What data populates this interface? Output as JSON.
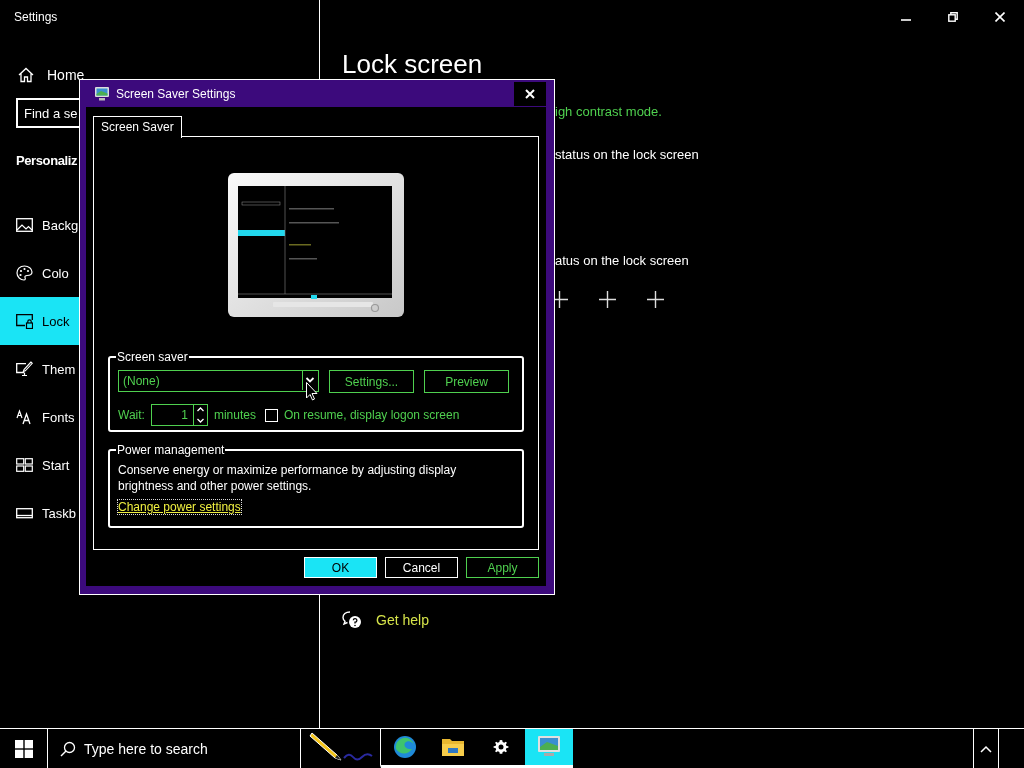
{
  "settings_window": {
    "title": "Settings"
  },
  "sidebar": {
    "home": "Home",
    "search": {
      "placeholder": "Find a se"
    },
    "section": "Personaliz",
    "items": [
      {
        "label": "Backg",
        "selected": false
      },
      {
        "label": "Colo",
        "selected": false
      },
      {
        "label": "Lock",
        "selected": true
      },
      {
        "label": "Them",
        "selected": false
      },
      {
        "label": "Fonts",
        "selected": false
      },
      {
        "label": "Start",
        "selected": false
      },
      {
        "label": "Taskb",
        "selected": false
      }
    ]
  },
  "content": {
    "title": "Lock screen",
    "lines": [
      {
        "text": "igh contrast mode.",
        "disabled": true
      },
      {
        "text": "status on the lock screen",
        "disabled": false
      },
      {
        "text": "atus on the lock screen",
        "disabled": false
      }
    ],
    "help_link": "Get help"
  },
  "dialog": {
    "title": "Screen Saver Settings",
    "tabs": [
      {
        "label": "Screen Saver",
        "selected": true
      }
    ],
    "screen_saver": {
      "legend": "Screen saver",
      "selection": "(None)",
      "buttons": [
        {
          "label": "Settings...",
          "disabled": true
        },
        {
          "label": "Preview",
          "disabled": true
        }
      ],
      "wait_label": "Wait:",
      "wait_value": "1",
      "wait_unit": "minutes",
      "disabled": true,
      "logon_option": {
        "label": "On resume, display logon screen",
        "checked": false
      }
    },
    "power": {
      "legend": "Power management",
      "description": "Conserve energy or maximize performance by adjusting display brightness and other power settings.",
      "link": "Change power settings"
    },
    "buttons": [
      {
        "label": "OK",
        "selected": true,
        "disabled": false
      },
      {
        "label": "Cancel",
        "selected": false,
        "disabled": false
      },
      {
        "label": "Apply",
        "selected": false,
        "disabled": true
      }
    ]
  },
  "taskbar": {
    "search": {
      "placeholder": "Type here to search"
    },
    "apps": [
      {
        "running": false,
        "selected": false
      },
      {
        "running": true,
        "selected": false
      },
      {
        "running": true,
        "selected": false
      },
      {
        "running": true,
        "selected": false
      },
      {
        "running": true,
        "selected": true
      }
    ]
  }
}
